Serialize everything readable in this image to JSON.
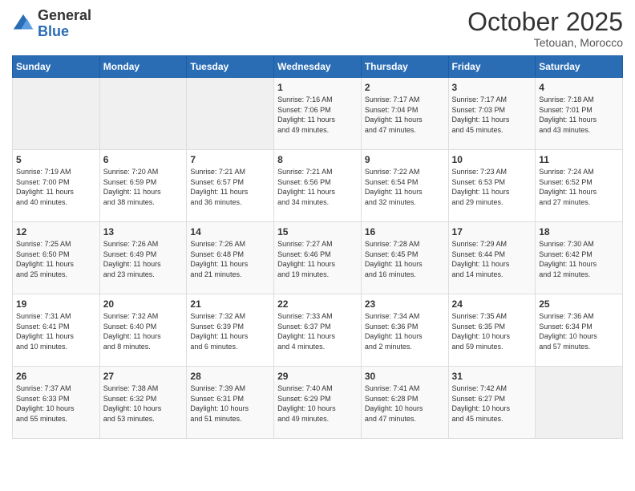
{
  "header": {
    "logo_general": "General",
    "logo_blue": "Blue",
    "month_title": "October 2025",
    "subtitle": "Tetouan, Morocco"
  },
  "weekdays": [
    "Sunday",
    "Monday",
    "Tuesday",
    "Wednesday",
    "Thursday",
    "Friday",
    "Saturday"
  ],
  "weeks": [
    [
      {
        "day": "",
        "info": ""
      },
      {
        "day": "",
        "info": ""
      },
      {
        "day": "",
        "info": ""
      },
      {
        "day": "1",
        "info": "Sunrise: 7:16 AM\nSunset: 7:06 PM\nDaylight: 11 hours\nand 49 minutes."
      },
      {
        "day": "2",
        "info": "Sunrise: 7:17 AM\nSunset: 7:04 PM\nDaylight: 11 hours\nand 47 minutes."
      },
      {
        "day": "3",
        "info": "Sunrise: 7:17 AM\nSunset: 7:03 PM\nDaylight: 11 hours\nand 45 minutes."
      },
      {
        "day": "4",
        "info": "Sunrise: 7:18 AM\nSunset: 7:01 PM\nDaylight: 11 hours\nand 43 minutes."
      }
    ],
    [
      {
        "day": "5",
        "info": "Sunrise: 7:19 AM\nSunset: 7:00 PM\nDaylight: 11 hours\nand 40 minutes."
      },
      {
        "day": "6",
        "info": "Sunrise: 7:20 AM\nSunset: 6:59 PM\nDaylight: 11 hours\nand 38 minutes."
      },
      {
        "day": "7",
        "info": "Sunrise: 7:21 AM\nSunset: 6:57 PM\nDaylight: 11 hours\nand 36 minutes."
      },
      {
        "day": "8",
        "info": "Sunrise: 7:21 AM\nSunset: 6:56 PM\nDaylight: 11 hours\nand 34 minutes."
      },
      {
        "day": "9",
        "info": "Sunrise: 7:22 AM\nSunset: 6:54 PM\nDaylight: 11 hours\nand 32 minutes."
      },
      {
        "day": "10",
        "info": "Sunrise: 7:23 AM\nSunset: 6:53 PM\nDaylight: 11 hours\nand 29 minutes."
      },
      {
        "day": "11",
        "info": "Sunrise: 7:24 AM\nSunset: 6:52 PM\nDaylight: 11 hours\nand 27 minutes."
      }
    ],
    [
      {
        "day": "12",
        "info": "Sunrise: 7:25 AM\nSunset: 6:50 PM\nDaylight: 11 hours\nand 25 minutes."
      },
      {
        "day": "13",
        "info": "Sunrise: 7:26 AM\nSunset: 6:49 PM\nDaylight: 11 hours\nand 23 minutes."
      },
      {
        "day": "14",
        "info": "Sunrise: 7:26 AM\nSunset: 6:48 PM\nDaylight: 11 hours\nand 21 minutes."
      },
      {
        "day": "15",
        "info": "Sunrise: 7:27 AM\nSunset: 6:46 PM\nDaylight: 11 hours\nand 19 minutes."
      },
      {
        "day": "16",
        "info": "Sunrise: 7:28 AM\nSunset: 6:45 PM\nDaylight: 11 hours\nand 16 minutes."
      },
      {
        "day": "17",
        "info": "Sunrise: 7:29 AM\nSunset: 6:44 PM\nDaylight: 11 hours\nand 14 minutes."
      },
      {
        "day": "18",
        "info": "Sunrise: 7:30 AM\nSunset: 6:42 PM\nDaylight: 11 hours\nand 12 minutes."
      }
    ],
    [
      {
        "day": "19",
        "info": "Sunrise: 7:31 AM\nSunset: 6:41 PM\nDaylight: 11 hours\nand 10 minutes."
      },
      {
        "day": "20",
        "info": "Sunrise: 7:32 AM\nSunset: 6:40 PM\nDaylight: 11 hours\nand 8 minutes."
      },
      {
        "day": "21",
        "info": "Sunrise: 7:32 AM\nSunset: 6:39 PM\nDaylight: 11 hours\nand 6 minutes."
      },
      {
        "day": "22",
        "info": "Sunrise: 7:33 AM\nSunset: 6:37 PM\nDaylight: 11 hours\nand 4 minutes."
      },
      {
        "day": "23",
        "info": "Sunrise: 7:34 AM\nSunset: 6:36 PM\nDaylight: 11 hours\nand 2 minutes."
      },
      {
        "day": "24",
        "info": "Sunrise: 7:35 AM\nSunset: 6:35 PM\nDaylight: 10 hours\nand 59 minutes."
      },
      {
        "day": "25",
        "info": "Sunrise: 7:36 AM\nSunset: 6:34 PM\nDaylight: 10 hours\nand 57 minutes."
      }
    ],
    [
      {
        "day": "26",
        "info": "Sunrise: 7:37 AM\nSunset: 6:33 PM\nDaylight: 10 hours\nand 55 minutes."
      },
      {
        "day": "27",
        "info": "Sunrise: 7:38 AM\nSunset: 6:32 PM\nDaylight: 10 hours\nand 53 minutes."
      },
      {
        "day": "28",
        "info": "Sunrise: 7:39 AM\nSunset: 6:31 PM\nDaylight: 10 hours\nand 51 minutes."
      },
      {
        "day": "29",
        "info": "Sunrise: 7:40 AM\nSunset: 6:29 PM\nDaylight: 10 hours\nand 49 minutes."
      },
      {
        "day": "30",
        "info": "Sunrise: 7:41 AM\nSunset: 6:28 PM\nDaylight: 10 hours\nand 47 minutes."
      },
      {
        "day": "31",
        "info": "Sunrise: 7:42 AM\nSunset: 6:27 PM\nDaylight: 10 hours\nand 45 minutes."
      },
      {
        "day": "",
        "info": ""
      }
    ]
  ]
}
